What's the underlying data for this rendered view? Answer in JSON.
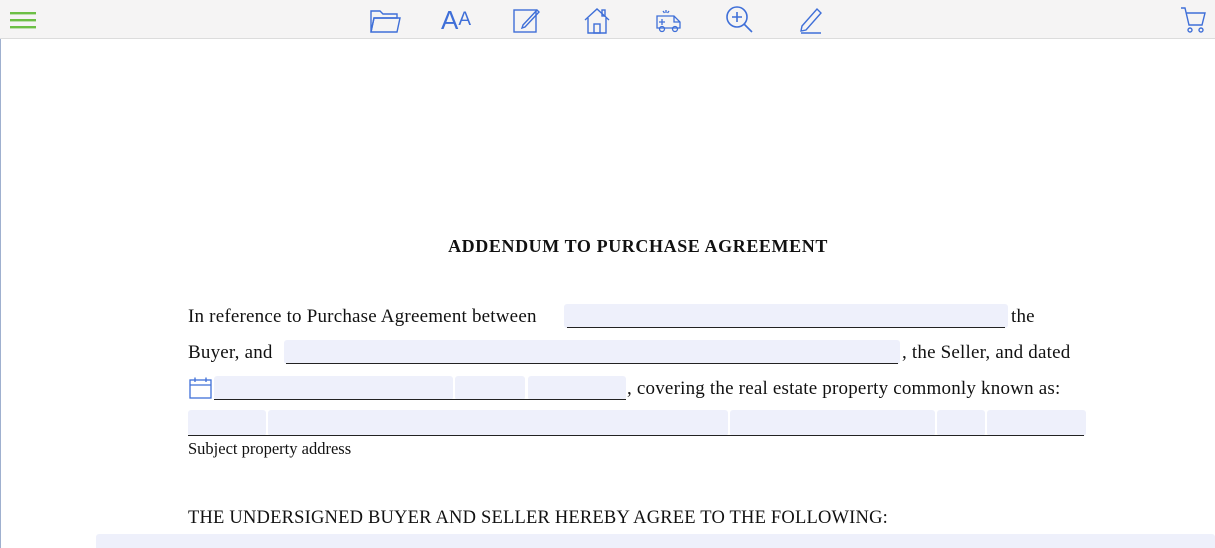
{
  "toolbar": {
    "icons": [
      "menu-icon",
      "folder-icon",
      "font-size-icon",
      "edit-icon",
      "home-icon",
      "ambulance-icon",
      "zoom-in-icon",
      "pen-icon",
      "cart-icon"
    ],
    "font_big": "A",
    "font_small": "A",
    "colors": {
      "accent": "#3f6fd8",
      "menu": "#6cbf45"
    }
  },
  "document": {
    "title": "ADDENDUM TO PURCHASE AGREEMENT",
    "line1_prefix": "In reference to Purchase Agreement between",
    "line1_suffix": "the",
    "line2_prefix": "Buyer, and",
    "line2_suffix": ", the Seller, and dated",
    "line3_suffix": ", covering the real estate property commonly known as:",
    "address_caption": "Subject property address",
    "agree_heading": "THE UNDERSIGNED BUYER AND SELLER HEREBY AGREE TO THE FOLLOWING:",
    "field_color": "#eef0fb"
  }
}
